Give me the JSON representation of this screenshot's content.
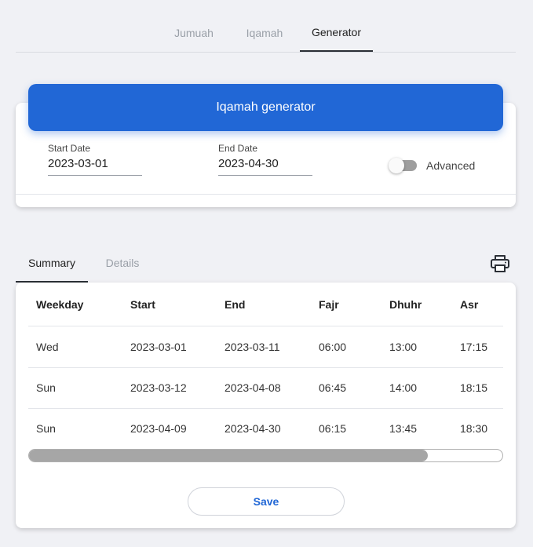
{
  "top_tabs": [
    {
      "label": "Jumuah",
      "active": false
    },
    {
      "label": "Iqamah",
      "active": false
    },
    {
      "label": "Generator",
      "active": true
    }
  ],
  "generator": {
    "title": "Iqamah generator",
    "start_date": {
      "label": "Start Date",
      "value": "2023-03-01"
    },
    "end_date": {
      "label": "End Date",
      "value": "2023-04-30"
    },
    "advanced": {
      "label": "Advanced",
      "enabled": false
    }
  },
  "result_tabs": [
    {
      "label": "Summary",
      "active": true
    },
    {
      "label": "Details",
      "active": false
    }
  ],
  "print_icon": "printer-icon",
  "table": {
    "columns": [
      "Weekday",
      "Start",
      "End",
      "Fajr",
      "Dhuhr",
      "Asr"
    ],
    "rows": [
      [
        "Wed",
        "2023-03-01",
        "2023-03-11",
        "06:00",
        "13:00",
        "17:15"
      ],
      [
        "Sun",
        "2023-03-12",
        "2023-04-08",
        "06:45",
        "14:00",
        "18:15"
      ],
      [
        "Sun",
        "2023-04-09",
        "2023-04-30",
        "06:15",
        "13:45",
        "18:30"
      ]
    ]
  },
  "scrollbar_position": 0.0,
  "save_label": "Save",
  "colors": {
    "primary": "#2167d6",
    "background": "#f0f1f5",
    "card": "#ffffff"
  }
}
